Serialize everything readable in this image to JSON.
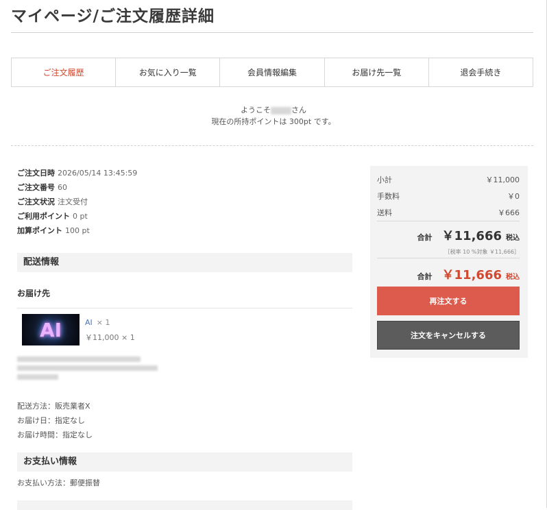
{
  "page": {
    "title": "マイページ/ご注文履歴詳細"
  },
  "tabs": [
    {
      "label": "ご注文履歴"
    },
    {
      "label": "お気に入り一覧"
    },
    {
      "label": "会員情報編集"
    },
    {
      "label": "お届け先一覧"
    },
    {
      "label": "退会手続き"
    }
  ],
  "welcome": {
    "prefix": "ようこそ",
    "suffix": "さん",
    "points_line": "現在の所持ポイントは 300pt です。"
  },
  "order": {
    "date_label": "ご注文日時",
    "date": "2026/05/14 13:45:59",
    "number_label": "ご注文番号",
    "number": "60",
    "status_label": "ご注文状況",
    "status": "注文受付",
    "used_points_label": "ご利用ポイント",
    "used_points": "0 pt",
    "added_points_label": "加算ポイント",
    "added_points": "100 pt"
  },
  "shipping": {
    "section_title": "配送情報",
    "destination_label": "お届け先",
    "item": {
      "name": "AI",
      "qty": "× 1",
      "price": "￥11,000 × 1",
      "thumb_text": "AI"
    },
    "method": "配送方法：販売業者X",
    "delivery_date": "お届け日：指定なし",
    "delivery_time": "お届け時間：指定なし"
  },
  "payment": {
    "section_title": "お支払い情報",
    "method": "お支払い方法：郵便振替"
  },
  "summary": {
    "subtotal_label": "小計",
    "subtotal": "￥11,000",
    "fee_label": "手数料",
    "fee": "￥0",
    "shipping_label": "送料",
    "shipping": "￥666",
    "total_label": "合計",
    "total": "￥11,666",
    "tax_incl": "税込",
    "tax_note": "［税率 10 %対象 ￥11,666］",
    "grand_label": "合計",
    "grand_total": "￥11,666",
    "grand_tax_incl": "税込",
    "reorder_button": "再注文する",
    "cancel_button": "注文をキャンセルする"
  },
  "colors": {
    "accent": "#d2482f",
    "reorder_bg": "#dd5b4d",
    "cancel_bg": "#5c5c5c",
    "panel_bg": "#f3f3f3"
  }
}
